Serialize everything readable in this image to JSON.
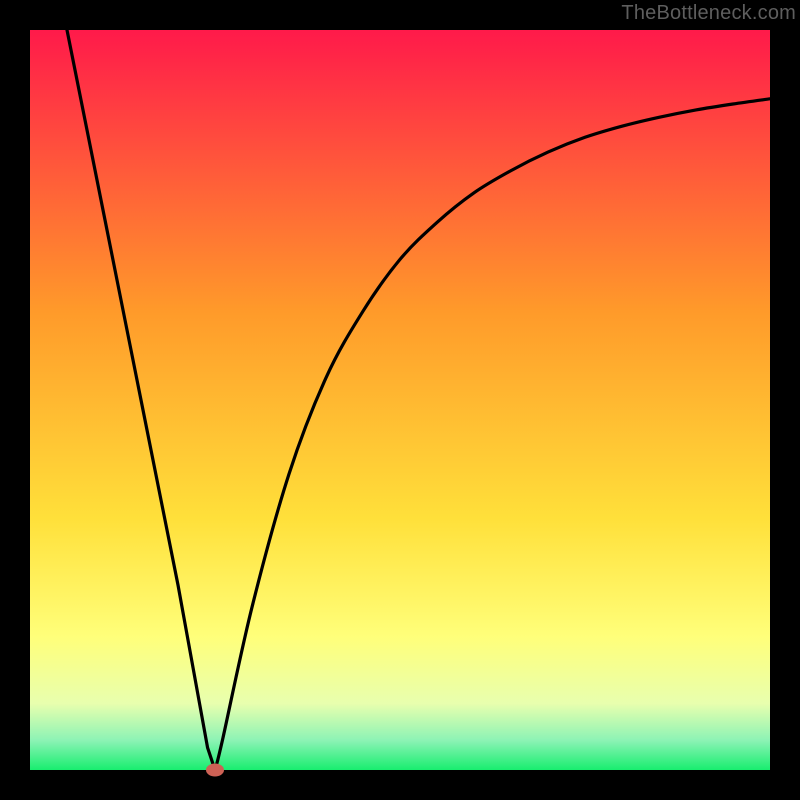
{
  "watermark": "TheBottleneck.com",
  "colors": {
    "bg_top": "#ff1a4a",
    "bg_orange": "#ff7a2a",
    "bg_yellow": "#ffe03a",
    "bg_lightyellow": "#ffff7a",
    "bg_paleyellow": "#f7ffb0",
    "bg_mint": "#9cf5c0",
    "bg_green": "#18ee6f",
    "curve": "#000000",
    "marker": "#cd6155",
    "frame": "#000000"
  },
  "chart_data": {
    "type": "line",
    "title": "",
    "xlabel": "",
    "ylabel": "",
    "xlim": [
      0,
      100
    ],
    "ylim": [
      0,
      100
    ],
    "grid": false,
    "legend": false,
    "annotations": [
      {
        "text": "TheBottleneck.com",
        "pos": "top-right"
      }
    ],
    "series": [
      {
        "name": "bottleneck-curve",
        "x": [
          5,
          10,
          15,
          20,
          24,
          25,
          26,
          30,
          35,
          40,
          45,
          50,
          55,
          60,
          65,
          70,
          75,
          80,
          85,
          90,
          95,
          100
        ],
        "y": [
          100,
          75,
          50,
          25,
          3,
          0,
          4,
          22,
          40,
          53,
          62,
          69,
          74,
          78,
          81,
          83.5,
          85.5,
          87,
          88.2,
          89.2,
          90,
          90.7
        ]
      }
    ],
    "marker": {
      "x": 25,
      "y": 0
    },
    "background_gradient_stops": [
      {
        "pct": 0,
        "color": "#ff1a4a"
      },
      {
        "pct": 38,
        "color": "#ff9a2a"
      },
      {
        "pct": 66,
        "color": "#ffe03a"
      },
      {
        "pct": 82,
        "color": "#ffff7a"
      },
      {
        "pct": 91,
        "color": "#e8ffae"
      },
      {
        "pct": 96,
        "color": "#8cf3b5"
      },
      {
        "pct": 100,
        "color": "#18ee6f"
      }
    ]
  }
}
